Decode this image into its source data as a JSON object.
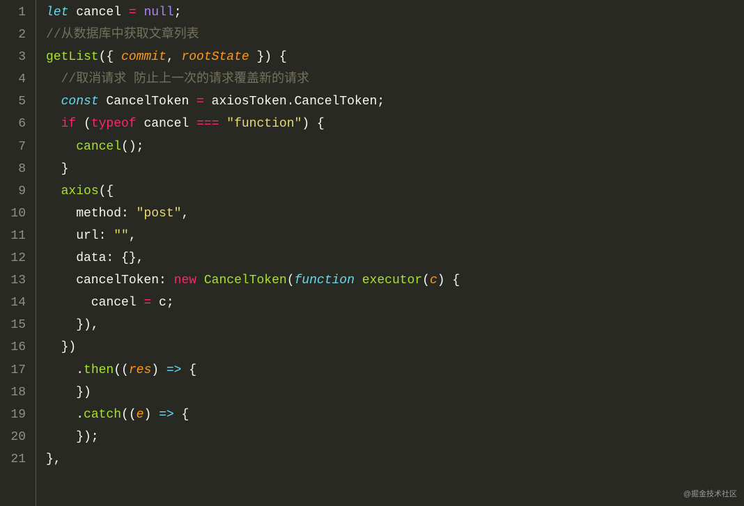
{
  "watermark": "@掘金技术社区",
  "lines": [
    {
      "n": "1",
      "tokens": [
        [
          "kw",
          "let "
        ],
        [
          "id",
          "cancel "
        ],
        [
          "op",
          "="
        ],
        [
          "id",
          " "
        ],
        [
          "num",
          "null"
        ],
        [
          "pun",
          ";"
        ]
      ]
    },
    {
      "n": "2",
      "tokens": [
        [
          "cm",
          "//从数据库中获取文章列表"
        ]
      ]
    },
    {
      "n": "3",
      "tokens": [
        [
          "fn",
          "getList"
        ],
        [
          "pun",
          "({ "
        ],
        [
          "pm",
          "commit"
        ],
        [
          "pun",
          ", "
        ],
        [
          "pm",
          "rootState"
        ],
        [
          "pun",
          " }) {"
        ]
      ]
    },
    {
      "n": "4",
      "tokens": [
        [
          "id",
          "  "
        ],
        [
          "cm",
          "//取消请求 防止上一次的请求覆盖新的请求"
        ]
      ]
    },
    {
      "n": "5",
      "tokens": [
        [
          "id",
          "  "
        ],
        [
          "kw",
          "const "
        ],
        [
          "id",
          "CancelToken "
        ],
        [
          "op",
          "="
        ],
        [
          "id",
          " axiosToken.CancelToken;"
        ]
      ]
    },
    {
      "n": "6",
      "tokens": [
        [
          "id",
          "  "
        ],
        [
          "kw2",
          "if"
        ],
        [
          "id",
          " ("
        ],
        [
          "kw2",
          "typeof"
        ],
        [
          "id",
          " cancel "
        ],
        [
          "op",
          "==="
        ],
        [
          "id",
          " "
        ],
        [
          "str",
          "\"function\""
        ],
        [
          "id",
          ") {"
        ]
      ]
    },
    {
      "n": "7",
      "tokens": [
        [
          "id",
          "    "
        ],
        [
          "fn",
          "cancel"
        ],
        [
          "id",
          "();"
        ]
      ]
    },
    {
      "n": "8",
      "tokens": [
        [
          "id",
          "  }"
        ]
      ]
    },
    {
      "n": "9",
      "tokens": [
        [
          "id",
          "  "
        ],
        [
          "fn",
          "axios"
        ],
        [
          "id",
          "({"
        ]
      ]
    },
    {
      "n": "10",
      "tokens": [
        [
          "id",
          "    method: "
        ],
        [
          "str",
          "\"post\""
        ],
        [
          "id",
          ","
        ]
      ]
    },
    {
      "n": "11",
      "tokens": [
        [
          "id",
          "    url: "
        ],
        [
          "str",
          "\"\""
        ],
        [
          "id",
          ","
        ]
      ]
    },
    {
      "n": "12",
      "tokens": [
        [
          "id",
          "    data: {},"
        ]
      ]
    },
    {
      "n": "13",
      "tokens": [
        [
          "id",
          "    cancelToken: "
        ],
        [
          "kw2",
          "new"
        ],
        [
          "id",
          " "
        ],
        [
          "fn",
          "CancelToken"
        ],
        [
          "id",
          "("
        ],
        [
          "kw",
          "function"
        ],
        [
          "id",
          " "
        ],
        [
          "fn",
          "executor"
        ],
        [
          "id",
          "("
        ],
        [
          "pm",
          "c"
        ],
        [
          "id",
          ") {"
        ]
      ]
    },
    {
      "n": "14",
      "tokens": [
        [
          "id",
          "      cancel "
        ],
        [
          "op",
          "="
        ],
        [
          "id",
          " c;"
        ]
      ]
    },
    {
      "n": "15",
      "tokens": [
        [
          "id",
          "    }),"
        ]
      ]
    },
    {
      "n": "16",
      "tokens": [
        [
          "id",
          "  })"
        ]
      ]
    },
    {
      "n": "17",
      "tokens": [
        [
          "id",
          "    ."
        ],
        [
          "fn",
          "then"
        ],
        [
          "id",
          "(("
        ],
        [
          "pm",
          "res"
        ],
        [
          "id",
          ") "
        ],
        [
          "kw",
          "=>"
        ],
        [
          "id",
          " {"
        ]
      ]
    },
    {
      "n": "18",
      "tokens": [
        [
          "id",
          "    })"
        ]
      ]
    },
    {
      "n": "19",
      "tokens": [
        [
          "id",
          "    ."
        ],
        [
          "fn",
          "catch"
        ],
        [
          "id",
          "(("
        ],
        [
          "pm",
          "e"
        ],
        [
          "id",
          ") "
        ],
        [
          "kw",
          "=>"
        ],
        [
          "id",
          " {"
        ]
      ]
    },
    {
      "n": "20",
      "tokens": [
        [
          "id",
          "    });"
        ]
      ]
    },
    {
      "n": "21",
      "tokens": [
        [
          "id",
          "},"
        ]
      ]
    }
  ]
}
